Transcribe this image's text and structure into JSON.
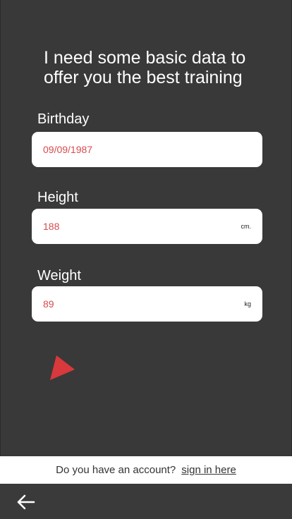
{
  "headline": "I need some basic data to offer you the best training",
  "fields": {
    "birthday": {
      "label": "Birthday",
      "value": "09/09/1987",
      "unit": ""
    },
    "height": {
      "label": "Height",
      "value": "188",
      "unit": "cm."
    },
    "weight": {
      "label": "Weight",
      "value": "89",
      "unit": "kg"
    }
  },
  "icons": {
    "next": "play-triangle-icon",
    "back": "arrow-left-icon"
  },
  "colors": {
    "background": "#393939",
    "accent": "#d9383c",
    "value_text": "#d94a4f"
  },
  "account": {
    "question": "Do you have an account?",
    "link": "sign in here"
  }
}
